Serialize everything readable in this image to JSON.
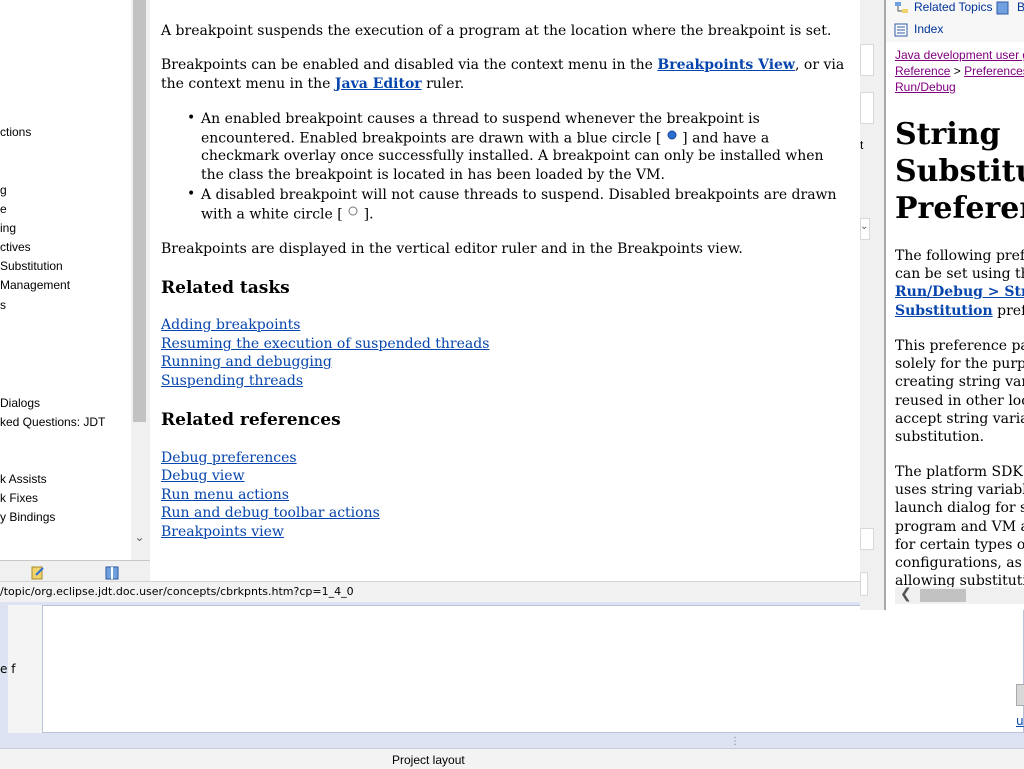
{
  "background_window": {
    "left_text": "e f",
    "bottom_label": "Project layout",
    "right_link": "u"
  },
  "toc": {
    "items": [
      {
        "label": "ctions"
      },
      {
        "label": "g"
      },
      {
        "label": "e"
      },
      {
        "label": "ing"
      },
      {
        "label": "ctives"
      },
      {
        "label": "Substitution"
      },
      {
        "label": "Management"
      },
      {
        "label": "s"
      },
      {
        "label": "Dialogs"
      },
      {
        "label": "ked Questions: JDT"
      },
      {
        "label": "k Assists"
      },
      {
        "label": "k Fixes"
      },
      {
        "label": "y Bindings"
      }
    ],
    "scroll_arrow": "⌄"
  },
  "status_bar": {
    "url": "/topic/org.eclipse.jdt.doc.user/concepts/cbrkpnts.htm?cp=1_4_0"
  },
  "content": {
    "intro": "A breakpoint suspends the execution of a program at the location where the breakpoint is set.",
    "para2_pre": "Breakpoints can be enabled and disabled via the context menu in the ",
    "para2_link1": "Breakpoints View",
    "para2_mid": ", or via the context menu in the ",
    "para2_link2": "Java Editor",
    "para2_post": " ruler.",
    "bullet1_pre": "An enabled breakpoint causes a thread to suspend whenever the breakpoint is encountered. Enabled breakpoints are drawn with a blue circle [ ",
    "bullet1_post": " ] and have a checkmark overlay once successfully installed. A breakpoint can only be installed when the class the breakpoint is located in has been loaded by the VM.",
    "bullet2_pre": "A disabled breakpoint will not cause threads to suspend. Disabled breakpoints are drawn with a white circle [ ",
    "bullet2_post": " ].",
    "para3": "Breakpoints are displayed in the vertical editor ruler and in the Breakpoints view.",
    "related_tasks_heading": "Related tasks",
    "related_tasks": [
      "Adding breakpoints",
      "Resuming the execution of suspended threads",
      "Running and debugging",
      "Suspending threads"
    ],
    "related_refs_heading": "Related references",
    "related_refs": [
      "Debug preferences",
      "Debug view",
      "Run menu actions",
      "Run and debug toolbar actions",
      "Breakpoints view"
    ]
  },
  "gap": {
    "fragment_t": "t"
  },
  "right_pane": {
    "related_topics": "Related Topics",
    "bookmarks_fragment": "B",
    "index": "Index",
    "crumb1": "Java development user g",
    "crumb2": "Reference",
    "crumb_sep": " > ",
    "crumb3": "Preferences",
    "crumb4": "Run/Debug",
    "title_lines": [
      "String",
      "Substituti",
      "Preferenc"
    ],
    "p1_lines": [
      "The following prefe",
      "can be set using the"
    ],
    "p1_link_lines": [
      "Run/Debug > Strin",
      "Substitution"
    ],
    "p1_tail": " prefere",
    "p2_lines": [
      "This preference page",
      "solely for the purpos",
      "creating string varia",
      "reused in other locat",
      "accept string variabl",
      "substitution."
    ],
    "p3_lines": [
      "The platform SDK f",
      "uses string variables",
      "launch dialog for set",
      "program and VM arg",
      "for certain types of l",
      "configurations, as w",
      "allowing substitution"
    ],
    "scroll_arrow": "❮"
  },
  "colors": {
    "link": "#0645ad",
    "visited_link": "#800080",
    "enabled_breakpoint": "#2d6fd1"
  }
}
